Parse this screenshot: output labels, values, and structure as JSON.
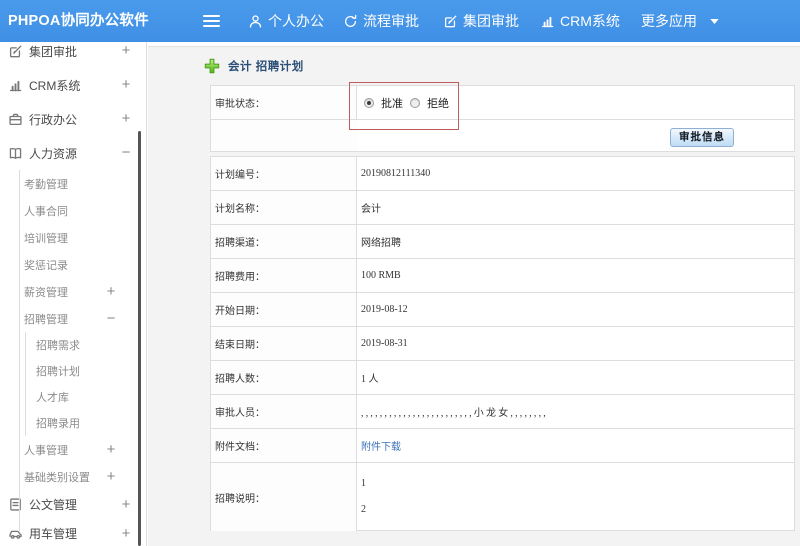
{
  "colors": {
    "header_blue": "#3f8fe5",
    "header_blue_light": "#4a9aec",
    "annotation_red": "#bc5c5c",
    "link_blue": "#3d74b8",
    "title_navy": "#2a4e76",
    "plus_green": "#67c32c"
  },
  "header": {
    "logo": "PHPOA协同办公软件",
    "menu_icon": "hamburger-icon",
    "nav": [
      {
        "label": "个人办公",
        "icon": "user-icon"
      },
      {
        "label": "流程审批",
        "icon": "process-icon"
      },
      {
        "label": "集团审批",
        "icon": "edit-icon"
      },
      {
        "label": "CRM系统",
        "icon": "chart-icon"
      },
      {
        "label": "更多应用",
        "icon": "caret-down-icon"
      }
    ]
  },
  "sidebar": {
    "items": [
      {
        "label": "集团审批",
        "level": 0,
        "icon": "edit-icon",
        "expander": "+"
      },
      {
        "label": "CRM系统",
        "level": 0,
        "icon": "chart-icon",
        "expander": "+"
      },
      {
        "label": "行政办公",
        "level": 0,
        "icon": "briefcase-icon",
        "expander": "+"
      },
      {
        "label": "人力资源",
        "level": 0,
        "icon": "book-icon",
        "expander": "−"
      },
      {
        "label": "考勤管理",
        "level": 1
      },
      {
        "label": "人事合同",
        "level": 1
      },
      {
        "label": "培训管理",
        "level": 1
      },
      {
        "label": "奖惩记录",
        "level": 1
      },
      {
        "label": "薪资管理",
        "level": 1,
        "expander": "+"
      },
      {
        "label": "招聘管理",
        "level": 1,
        "expander": "−"
      },
      {
        "label": "招聘需求",
        "level": 2
      },
      {
        "label": "招聘计划",
        "level": 2
      },
      {
        "label": "人才库",
        "level": 2
      },
      {
        "label": "招聘录用",
        "level": 2
      },
      {
        "label": "人事管理",
        "level": 1,
        "expander": "+"
      },
      {
        "label": "基础类别设置",
        "level": 1,
        "expander": "+"
      },
      {
        "label": "公文管理",
        "level": 0,
        "icon": "doc-icon",
        "expander": "+",
        "compact": true
      },
      {
        "label": "用车管理",
        "level": 0,
        "icon": "car-icon",
        "expander": "+",
        "compact": true
      }
    ]
  },
  "main": {
    "title_icon": "plus-icon",
    "page_title": "会计 招聘计划",
    "approval": {
      "status_label": "审批状态：",
      "options": [
        {
          "label": "批准",
          "checked": true
        },
        {
          "label": "拒绝",
          "checked": false
        }
      ],
      "info_button": "审批信息"
    },
    "fields": [
      {
        "label": "计划编号：",
        "value": "20190812111340"
      },
      {
        "label": "计划名称：",
        "value": "会计"
      },
      {
        "label": "招聘渠道：",
        "value": "网络招聘"
      },
      {
        "label": "招聘费用：",
        "value": "100 RMB"
      },
      {
        "label": "开始日期：",
        "value": "2019-08-12"
      },
      {
        "label": "结束日期：",
        "value": "2019-08-31"
      },
      {
        "label": "招聘人数：",
        "value": "1 人"
      },
      {
        "label": "审批人员：",
        "value": ",,,,,,,,,,,,,,,,,,,,,,,,小龙女,,,,,,,,",
        "style": "commas"
      },
      {
        "label": "附件文档：",
        "value": "附件下载",
        "type": "link"
      },
      {
        "label": "招聘说明：",
        "lines": [
          "1",
          "2"
        ],
        "type": "multiline"
      }
    ]
  }
}
